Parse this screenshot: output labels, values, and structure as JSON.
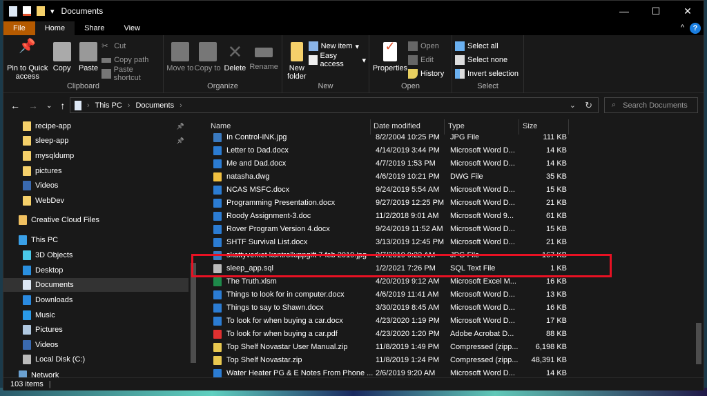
{
  "window": {
    "title": "Documents",
    "minimize": "—",
    "maximize": "☐",
    "close": "✕",
    "help": "?",
    "collapse": "^"
  },
  "tabs": [
    {
      "label": "File"
    },
    {
      "label": "Home"
    },
    {
      "label": "Share"
    },
    {
      "label": "View"
    }
  ],
  "ribbon": {
    "clipboard": {
      "label": "Clipboard",
      "pin": "Pin to Quick access",
      "copy": "Copy",
      "paste": "Paste",
      "cut": "Cut",
      "copy_path": "Copy path",
      "paste_shortcut": "Paste shortcut"
    },
    "organize": {
      "label": "Organize",
      "move_to": "Move to",
      "copy_to": "Copy to",
      "delete": "Delete",
      "rename": "Rename"
    },
    "new": {
      "label": "New",
      "new_folder": "New folder",
      "new_item": "New item",
      "easy_access": "Easy access"
    },
    "open": {
      "label": "Open",
      "properties": "Properties",
      "open": "Open",
      "edit": "Edit",
      "history": "History"
    },
    "select": {
      "label": "Select",
      "select_all": "Select all",
      "select_none": "Select none",
      "invert": "Invert selection"
    }
  },
  "address": {
    "crumbs": [
      "This PC",
      "Documents"
    ],
    "search_placeholder": "Search Documents"
  },
  "sidebar": [
    {
      "label": "recipe-app",
      "icon": "folder",
      "indent": 1,
      "pinned": true
    },
    {
      "label": "sleep-app",
      "icon": "folder",
      "indent": 1,
      "pinned": true
    },
    {
      "label": "mysqldump",
      "icon": "folder",
      "indent": 1
    },
    {
      "label": "pictures",
      "icon": "folder",
      "indent": 1
    },
    {
      "label": "Videos",
      "icon": "video",
      "indent": 1
    },
    {
      "label": "WebDev",
      "icon": "folder",
      "indent": 1
    },
    {
      "label": "Creative Cloud Files",
      "icon": "creative-cloud",
      "indent": 0
    },
    {
      "label": "This PC",
      "icon": "computer",
      "indent": 0
    },
    {
      "label": "3D Objects",
      "icon": "cube",
      "indent": 1
    },
    {
      "label": "Desktop",
      "icon": "desktop",
      "indent": 1
    },
    {
      "label": "Documents",
      "icon": "document",
      "indent": 1,
      "selected": true
    },
    {
      "label": "Downloads",
      "icon": "download",
      "indent": 1
    },
    {
      "label": "Music",
      "icon": "music",
      "indent": 1
    },
    {
      "label": "Pictures",
      "icon": "picture",
      "indent": 1
    },
    {
      "label": "Videos",
      "icon": "video",
      "indent": 1
    },
    {
      "label": "Local Disk (C:)",
      "icon": "drive",
      "indent": 1
    },
    {
      "label": "Network",
      "icon": "network",
      "indent": 0
    }
  ],
  "columns": {
    "name": "Name",
    "date": "Date modified",
    "type": "Type",
    "size": "Size"
  },
  "files": [
    {
      "name": "In Control-INK.jpg",
      "date": "8/2/2004 10:25 PM",
      "type": "JPG File",
      "size": "111 KB",
      "icon": "image"
    },
    {
      "name": "Letter to Dad.docx",
      "date": "4/14/2019 3:44 PM",
      "type": "Microsoft Word D...",
      "size": "14 KB",
      "icon": "word"
    },
    {
      "name": "Me and Dad.docx",
      "date": "4/7/2019 1:53 PM",
      "type": "Microsoft Word D...",
      "size": "14 KB",
      "icon": "word"
    },
    {
      "name": "natasha.dwg",
      "date": "4/6/2019 10:21 PM",
      "type": "DWG File",
      "size": "35 KB",
      "icon": "dwg"
    },
    {
      "name": "NCAS MSFC.docx",
      "date": "9/24/2019 5:54 AM",
      "type": "Microsoft Word D...",
      "size": "15 KB",
      "icon": "word"
    },
    {
      "name": "Programming Presentation.docx",
      "date": "9/27/2019 12:25 PM",
      "type": "Microsoft Word D...",
      "size": "21 KB",
      "icon": "word"
    },
    {
      "name": "Roody Assignment-3.doc",
      "date": "11/2/2018 9:01 AM",
      "type": "Microsoft Word 9...",
      "size": "61 KB",
      "icon": "word"
    },
    {
      "name": "Rover Program Version 4.docx",
      "date": "9/24/2019 11:52 AM",
      "type": "Microsoft Word D...",
      "size": "15 KB",
      "icon": "word"
    },
    {
      "name": "SHTF Survival List.docx",
      "date": "3/13/2019 12:45 PM",
      "type": "Microsoft Word D...",
      "size": "21 KB",
      "icon": "word"
    },
    {
      "name": "skattyverket kontrolluppgift 7 feb 2019.jpg",
      "date": "2/7/2019 9:22 AM",
      "type": "JPG File",
      "size": "167 KB",
      "icon": "image"
    },
    {
      "name": "sleep_app.sql",
      "date": "1/2/2021 7:26 PM",
      "type": "SQL Text File",
      "size": "1 KB",
      "icon": "text"
    },
    {
      "name": "The Truth.xlsm",
      "date": "4/20/2019 9:12 AM",
      "type": "Microsoft Excel M...",
      "size": "16 KB",
      "icon": "excel"
    },
    {
      "name": "Things to look for in computer.docx",
      "date": "4/6/2019 11:41 AM",
      "type": "Microsoft Word D...",
      "size": "13 KB",
      "icon": "word"
    },
    {
      "name": "Things to say to Shawn.docx",
      "date": "3/30/2019 8:45 AM",
      "type": "Microsoft Word D...",
      "size": "16 KB",
      "icon": "word"
    },
    {
      "name": "To look for when buying a car.docx",
      "date": "4/23/2020 1:19 PM",
      "type": "Microsoft Word D...",
      "size": "17 KB",
      "icon": "word"
    },
    {
      "name": "To look for when buying a car.pdf",
      "date": "4/23/2020 1:20 PM",
      "type": "Adobe Acrobat D...",
      "size": "88 KB",
      "icon": "pdf"
    },
    {
      "name": "Top Shelf Novastar User Manual.zip",
      "date": "11/8/2019 1:49 PM",
      "type": "Compressed (zipp...",
      "size": "6,198 KB",
      "icon": "zip"
    },
    {
      "name": "Top Shelf Novastar.zip",
      "date": "11/8/2019 1:24 PM",
      "type": "Compressed (zipp...",
      "size": "48,391 KB",
      "icon": "zip"
    },
    {
      "name": "Water Heater PG & E Notes From Phone ...",
      "date": "2/6/2019 9:20 AM",
      "type": "Microsoft Word D...",
      "size": "14 KB",
      "icon": "word"
    }
  ],
  "highlighted_file": "sleep_app.sql",
  "status": {
    "items": "103 items"
  },
  "colors": {
    "file_tab": "#b55a00",
    "highlight": "#e81123",
    "folder": "#f5d06a",
    "word": "#2b7cd3"
  }
}
